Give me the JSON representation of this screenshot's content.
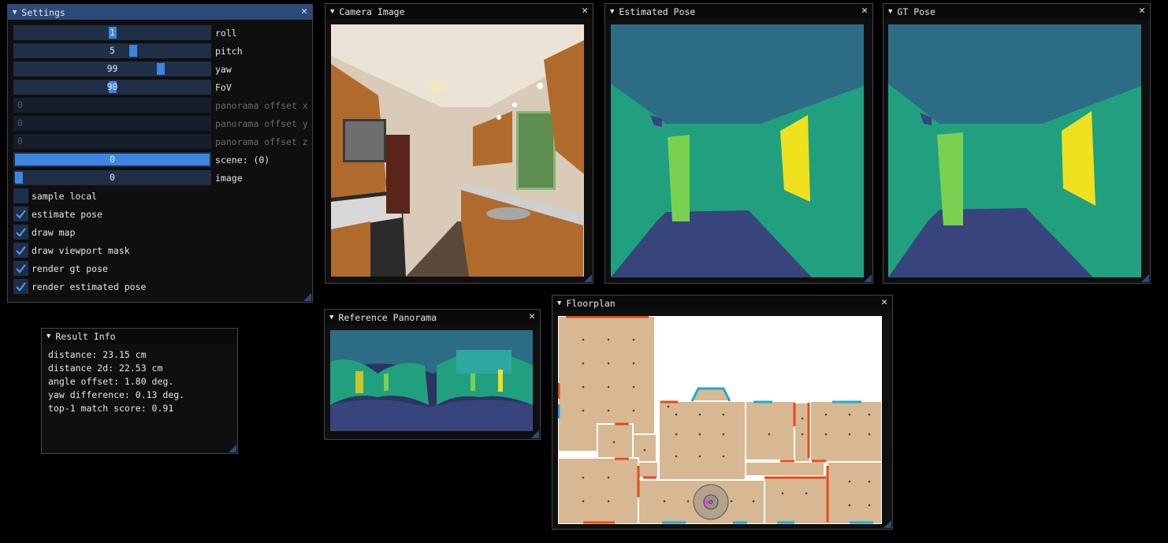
{
  "settings": {
    "title": "Settings",
    "sliders": [
      {
        "label": "roll",
        "value": "1",
        "frac": 0.5,
        "enabled": true
      },
      {
        "label": "pitch",
        "value": "5",
        "frac": 0.61,
        "enabled": true
      },
      {
        "label": "yaw",
        "value": "99",
        "frac": 0.76,
        "enabled": true
      },
      {
        "label": "FoV",
        "value": "90",
        "frac": 0.5,
        "enabled": true
      },
      {
        "label": "panorama offset x",
        "value": "0",
        "enabled": false
      },
      {
        "label": "panorama offset y",
        "value": "0",
        "enabled": false
      },
      {
        "label": "panorama offset z",
        "value": "0",
        "enabled": false
      },
      {
        "label": "scene: (0)",
        "value": "0",
        "fill": 1.0,
        "enabled": true
      },
      {
        "label": "image",
        "value": "0",
        "frac": 0.0,
        "enabled": true
      }
    ],
    "checkboxes": [
      {
        "label": "sample local",
        "checked": false
      },
      {
        "label": "estimate pose",
        "checked": true
      },
      {
        "label": "draw map",
        "checked": true
      },
      {
        "label": "draw viewport mask",
        "checked": true
      },
      {
        "label": "render gt pose",
        "checked": true
      },
      {
        "label": "render estimated pose",
        "checked": true
      }
    ]
  },
  "camera": {
    "title": "Camera Image"
  },
  "estimated": {
    "title": "Estimated Pose"
  },
  "gt": {
    "title": "GT Pose"
  },
  "panorama": {
    "title": "Reference Panorama"
  },
  "floorplan": {
    "title": "Floorplan"
  },
  "result": {
    "title": "Result Info",
    "lines": [
      "distance: 23.15 cm",
      "distance 2d: 22.53 cm",
      "angle offset: 1.80 deg.",
      "yaw difference: 0.13 deg.",
      "top-1 match score: 0.91"
    ]
  },
  "icons": {
    "collapse": "triangle-down-icon",
    "close": "close-icon",
    "check": "checkmark-icon"
  },
  "colors": {
    "accent": "#3d85e0",
    "frame": "#1f2f48",
    "title_active": "#294a7a"
  }
}
